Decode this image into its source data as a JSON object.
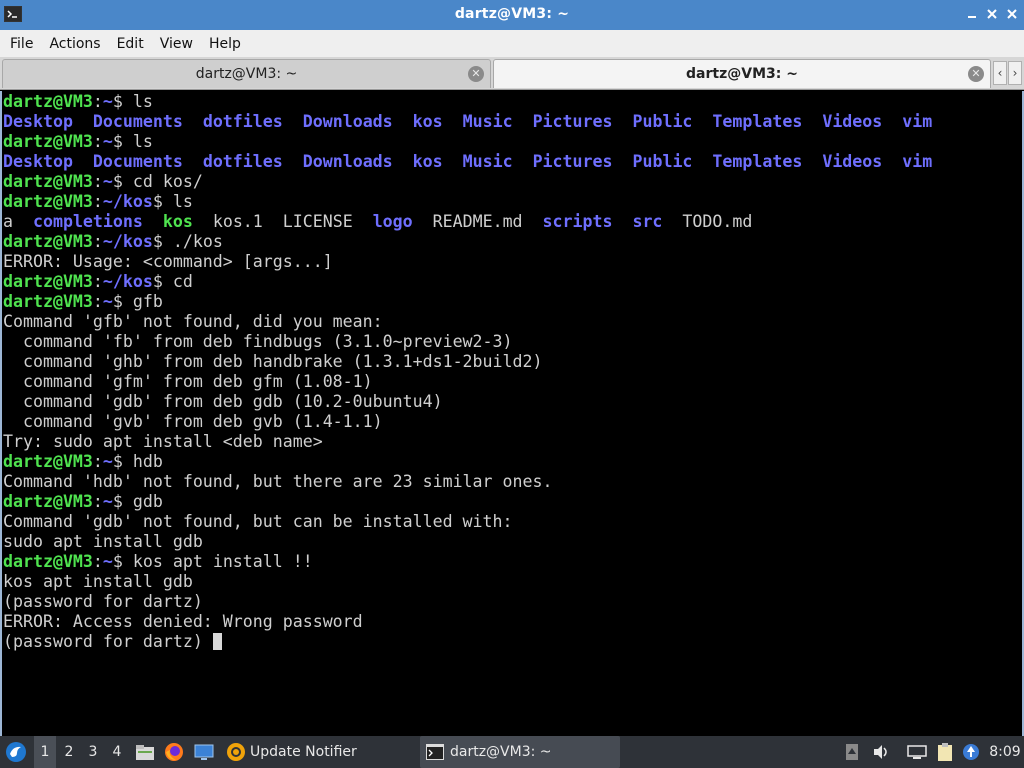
{
  "window": {
    "title": "dartz@VM3: ~"
  },
  "menu": {
    "items": [
      "File",
      "Actions",
      "Edit",
      "View",
      "Help"
    ]
  },
  "tabs": [
    {
      "label": "dartz@VM3: ~",
      "active": false
    },
    {
      "label": "dartz@VM3: ~",
      "active": true
    }
  ],
  "terminal": {
    "prompt_user": "dartz@VM3",
    "lines": [
      [
        {
          "t": "dartz@VM3",
          "c": "user"
        },
        {
          "t": ":"
        },
        {
          "t": "~",
          "c": "path"
        },
        {
          "t": "$ ls"
        }
      ],
      [
        {
          "t": "Desktop",
          "c": "dir"
        },
        {
          "t": "  "
        },
        {
          "t": "Documents",
          "c": "dir"
        },
        {
          "t": "  "
        },
        {
          "t": "dotfiles",
          "c": "dir"
        },
        {
          "t": "  "
        },
        {
          "t": "Downloads",
          "c": "dir"
        },
        {
          "t": "  "
        },
        {
          "t": "kos",
          "c": "dir"
        },
        {
          "t": "  "
        },
        {
          "t": "Music",
          "c": "dir"
        },
        {
          "t": "  "
        },
        {
          "t": "Pictures",
          "c": "dir"
        },
        {
          "t": "  "
        },
        {
          "t": "Public",
          "c": "dir"
        },
        {
          "t": "  "
        },
        {
          "t": "Templates",
          "c": "dir"
        },
        {
          "t": "  "
        },
        {
          "t": "Videos",
          "c": "dir"
        },
        {
          "t": "  "
        },
        {
          "t": "vim",
          "c": "dir"
        }
      ],
      [
        {
          "t": "dartz@VM3",
          "c": "user"
        },
        {
          "t": ":"
        },
        {
          "t": "~",
          "c": "path"
        },
        {
          "t": "$ ls"
        }
      ],
      [
        {
          "t": "Desktop",
          "c": "dir"
        },
        {
          "t": "  "
        },
        {
          "t": "Documents",
          "c": "dir"
        },
        {
          "t": "  "
        },
        {
          "t": "dotfiles",
          "c": "dir"
        },
        {
          "t": "  "
        },
        {
          "t": "Downloads",
          "c": "dir"
        },
        {
          "t": "  "
        },
        {
          "t": "kos",
          "c": "dir"
        },
        {
          "t": "  "
        },
        {
          "t": "Music",
          "c": "dir"
        },
        {
          "t": "  "
        },
        {
          "t": "Pictures",
          "c": "dir"
        },
        {
          "t": "  "
        },
        {
          "t": "Public",
          "c": "dir"
        },
        {
          "t": "  "
        },
        {
          "t": "Templates",
          "c": "dir"
        },
        {
          "t": "  "
        },
        {
          "t": "Videos",
          "c": "dir"
        },
        {
          "t": "  "
        },
        {
          "t": "vim",
          "c": "dir"
        }
      ],
      [
        {
          "t": "dartz@VM3",
          "c": "user"
        },
        {
          "t": ":"
        },
        {
          "t": "~",
          "c": "path"
        },
        {
          "t": "$ cd kos/"
        }
      ],
      [
        {
          "t": "dartz@VM3",
          "c": "user"
        },
        {
          "t": ":"
        },
        {
          "t": "~/kos",
          "c": "path"
        },
        {
          "t": "$ ls"
        }
      ],
      [
        {
          "t": "a  "
        },
        {
          "t": "completions",
          "c": "dir"
        },
        {
          "t": "  "
        },
        {
          "t": "kos",
          "c": "exe"
        },
        {
          "t": "  kos.1  LICENSE  "
        },
        {
          "t": "logo",
          "c": "dir"
        },
        {
          "t": "  README.md  "
        },
        {
          "t": "scripts",
          "c": "dir"
        },
        {
          "t": "  "
        },
        {
          "t": "src",
          "c": "dir"
        },
        {
          "t": "  TODO.md"
        }
      ],
      [
        {
          "t": "dartz@VM3",
          "c": "user"
        },
        {
          "t": ":"
        },
        {
          "t": "~/kos",
          "c": "path"
        },
        {
          "t": "$ ./kos"
        }
      ],
      [
        {
          "t": "ERROR: Usage: <command> [args...]"
        }
      ],
      [
        {
          "t": "dartz@VM3",
          "c": "user"
        },
        {
          "t": ":"
        },
        {
          "t": "~/kos",
          "c": "path"
        },
        {
          "t": "$ cd"
        }
      ],
      [
        {
          "t": "dartz@VM3",
          "c": "user"
        },
        {
          "t": ":"
        },
        {
          "t": "~",
          "c": "path"
        },
        {
          "t": "$ gfb"
        }
      ],
      [
        {
          "t": "Command 'gfb' not found, did you mean:"
        }
      ],
      [
        {
          "t": "  command 'fb' from deb findbugs (3.1.0~preview2-3)"
        }
      ],
      [
        {
          "t": "  command 'ghb' from deb handbrake (1.3.1+ds1-2build2)"
        }
      ],
      [
        {
          "t": "  command 'gfm' from deb gfm (1.08-1)"
        }
      ],
      [
        {
          "t": "  command 'gdb' from deb gdb (10.2-0ubuntu4)"
        }
      ],
      [
        {
          "t": "  command 'gvb' from deb gvb (1.4-1.1)"
        }
      ],
      [
        {
          "t": "Try: sudo apt install <deb name>"
        }
      ],
      [
        {
          "t": "dartz@VM3",
          "c": "user"
        },
        {
          "t": ":"
        },
        {
          "t": "~",
          "c": "path"
        },
        {
          "t": "$ hdb"
        }
      ],
      [
        {
          "t": "Command 'hdb' not found, but there are 23 similar ones."
        }
      ],
      [
        {
          "t": "dartz@VM3",
          "c": "user"
        },
        {
          "t": ":"
        },
        {
          "t": "~",
          "c": "path"
        },
        {
          "t": "$ gdb"
        }
      ],
      [
        {
          "t": "Command 'gdb' not found, but can be installed with:"
        }
      ],
      [
        {
          "t": "sudo apt install gdb"
        }
      ],
      [
        {
          "t": "dartz@VM3",
          "c": "user"
        },
        {
          "t": ":"
        },
        {
          "t": "~",
          "c": "path"
        },
        {
          "t": "$ kos apt install !!"
        }
      ],
      [
        {
          "t": "kos apt install gdb"
        }
      ],
      [
        {
          "t": "(password for dartz)"
        }
      ],
      [
        {
          "t": "ERROR: Access denied: Wrong password"
        }
      ],
      [
        {
          "t": "(password for dartz) "
        },
        {
          "t": "",
          "c": "cursor"
        }
      ]
    ]
  },
  "taskbar": {
    "workspaces": [
      "1",
      "2",
      "3",
      "4"
    ],
    "active_workspace": "1",
    "tasks": [
      {
        "label": "Update Notifier",
        "icon": "update-notifier-icon"
      },
      {
        "label": "dartz@VM3: ~",
        "icon": "terminal-icon"
      }
    ],
    "clock": "8:09"
  },
  "colors": {
    "titlebar": "#4a87c9",
    "prompt_green": "#4fe34f",
    "dir_blue": "#6f6fff",
    "taskbar": "#2e3238"
  }
}
